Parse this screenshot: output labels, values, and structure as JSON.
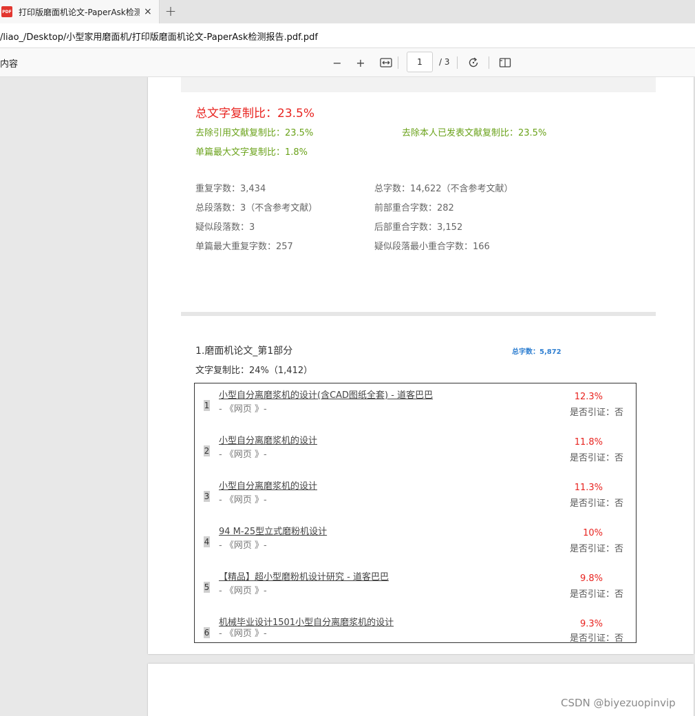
{
  "tab": {
    "icon_text": "PDF",
    "title": "打印版磨面机论文-PaperAsk检测",
    "close": "×",
    "new_tab": "+"
  },
  "address": {
    "url": "/liao_/Desktop/小型家用磨面机/打印版磨面机论文-PaperAsk检测报告.pdf.pdf"
  },
  "toolbar": {
    "contents_label": "内容",
    "zoom_out": "−",
    "zoom_in": "+",
    "fit_width": "⟷",
    "page_current": "1",
    "page_total": "/ 3",
    "rotate": "⟳",
    "two_page": "▯▯"
  },
  "summary": {
    "total_ratio": "总文字复制比：23.5%",
    "exclude_refs": "去除引用文献复制比：23.5%",
    "exclude_self": "去除本人已发表文献复制比：23.5%",
    "max_single": "单篇最大文字复制比：1.8%",
    "stats": [
      "重复字数：3,434",
      "总字数：14,622（不含参考文献）",
      "总段落数：3（不含参考文献）",
      "前部重合字数：282",
      "疑似段落数：3",
      "后部重合字数：3,152",
      "单篇最大重复字数：257",
      "疑似段落最小重合字数：166"
    ]
  },
  "part": {
    "title": "1.磨面机论文_第1部分",
    "total_words": "总字数：5,872",
    "ratio": "文字复制比：24%（1,412）"
  },
  "sources": [
    {
      "num": "1",
      "title": "小型自分离磨浆机的设计(含CAD图纸全套) - 道客巴巴",
      "type": "- 《网页 》-",
      "pct": "12.3%",
      "cite": "是否引证：否"
    },
    {
      "num": "2",
      "title": "小型自分离磨浆机的设计",
      "type": "- 《网页 》-",
      "pct": "11.8%",
      "cite": "是否引证：否"
    },
    {
      "num": "3",
      "title": "小型自分离磨浆机的设计",
      "type": "- 《网页 》-",
      "pct": "11.3%",
      "cite": "是否引证：否"
    },
    {
      "num": "4",
      "title": "94 M-25型立式磨粉机设计",
      "type": "- 《网页 》-",
      "pct": "10%",
      "cite": "是否引证：否"
    },
    {
      "num": "5",
      "title": "【精品】超小型磨粉机设计研究 - 道客巴巴",
      "type": "- 《网页 》-",
      "pct": "9.8%",
      "cite": "是否引证：否"
    },
    {
      "num": "6",
      "title": "机械毕业设计1501小型自分离磨浆机的设计",
      "type": "- 《网页 》-",
      "pct": "9.3%",
      "cite": "是否引证：否"
    }
  ],
  "watermark": "CSDN @biyezuopinvip",
  "colors": {
    "red": "#e8231f",
    "green": "#6aa21a",
    "blue": "#2f7fd1"
  }
}
